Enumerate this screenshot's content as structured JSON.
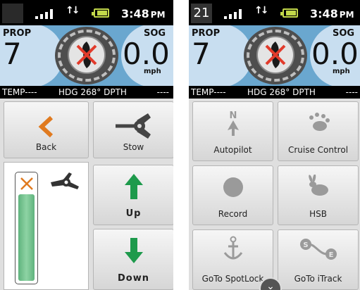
{
  "left": {
    "status": {
      "time": "3:48",
      "ampm": "PM"
    },
    "gauge": {
      "prop_label": "PROP",
      "prop_value": "7",
      "sog_label": "SOG",
      "sog_value": "0.0",
      "sog_unit": "mph"
    },
    "info": {
      "temp": "TEMP----",
      "hdg": "HDG 268° DPTH",
      "dpth": "----"
    },
    "buttons": {
      "back": "Back",
      "stow": "Stow",
      "up": "Up",
      "down": "Down"
    }
  },
  "right": {
    "status": {
      "notification_count": "21",
      "time": "3:48",
      "ampm": "PM"
    },
    "gauge": {
      "prop_label": "PROP",
      "prop_value": "7",
      "sog_label": "SOG",
      "sog_value": "0.0",
      "sog_unit": "mph"
    },
    "info": {
      "temp": "TEMP----",
      "hdg": "HDG 268° DPTH",
      "dpth": "----"
    },
    "buttons": {
      "autopilot": "Autopilot",
      "cruise_control": "Cruise Control",
      "record": "Record",
      "hsb": "HSB",
      "goto_spotlock": "GoTo SpotLock",
      "goto_itrack": "GoTo iTrack"
    }
  },
  "colors": {
    "gauge_bg": "#6aa7cf",
    "gauge_light": "#c8def0",
    "arrow_green": "#1e9a4c",
    "back_orange": "#e07a1f",
    "battery": "#c2d84a",
    "trim_fill": "#6cc28c"
  },
  "trim_level": 0.82,
  "icons": [
    "signal-icon",
    "data-arrows-icon",
    "battery-icon",
    "prop-disabled-icon",
    "back-chevron-icon",
    "stow-icon",
    "up-arrow-icon",
    "down-arrow-icon",
    "trim-motor-icon",
    "north-arrow-icon",
    "cruise-icon",
    "record-icon",
    "rabbit-icon",
    "anchor-icon",
    "itrack-icon",
    "chevron-down-icon"
  ]
}
